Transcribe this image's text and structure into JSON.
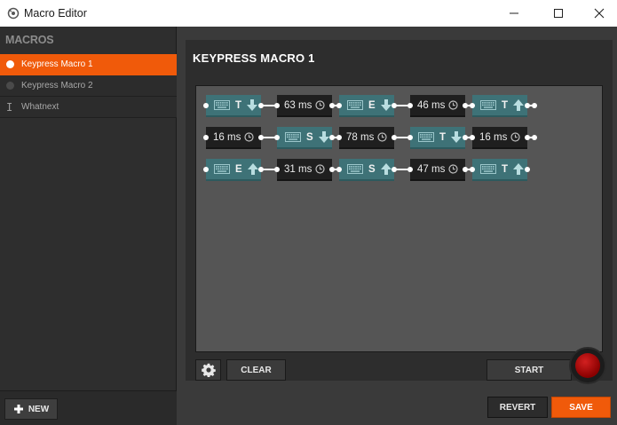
{
  "window": {
    "title": "Macro Editor"
  },
  "sidebar": {
    "header": "MACROS",
    "items": [
      {
        "label": "Keypress Macro 1",
        "active": true,
        "icon": "dot-icon"
      },
      {
        "label": "Keypress Macro 2",
        "active": false,
        "icon": "dot-icon"
      },
      {
        "label": "Whatnext",
        "active": false,
        "icon": "text-cursor-icon"
      }
    ],
    "new_label": "NEW"
  },
  "editor": {
    "title": "KEYPRESS MACRO 1",
    "rows": [
      [
        {
          "type": "key",
          "key": "T",
          "action": "down"
        },
        {
          "type": "delay",
          "value": "63 ms"
        },
        {
          "type": "key",
          "key": "E",
          "action": "down"
        },
        {
          "type": "delay",
          "value": "46 ms"
        },
        {
          "type": "key",
          "key": "T",
          "action": "up"
        }
      ],
      [
        {
          "type": "delay",
          "value": "16 ms"
        },
        {
          "type": "key",
          "key": "S",
          "action": "down"
        },
        {
          "type": "delay",
          "value": "78 ms"
        },
        {
          "type": "key",
          "key": "T",
          "action": "down"
        },
        {
          "type": "delay",
          "value": "16 ms"
        }
      ],
      [
        {
          "type": "key",
          "key": "E",
          "action": "up"
        },
        {
          "type": "delay",
          "value": "31 ms"
        },
        {
          "type": "key",
          "key": "S",
          "action": "up"
        },
        {
          "type": "delay",
          "value": "47 ms"
        },
        {
          "type": "key",
          "key": "T",
          "action": "up"
        }
      ]
    ],
    "clear_label": "CLEAR",
    "start_label": "START"
  },
  "footer": {
    "revert_label": "REVERT",
    "save_label": "SAVE"
  },
  "colors": {
    "accent": "#f05a0a",
    "key_node": "#3e7277",
    "delay_node": "#1f1f1f"
  }
}
